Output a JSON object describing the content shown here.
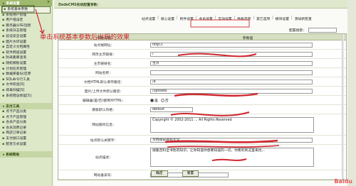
{
  "sidebar": {
    "section1": "系统设置",
    "section1_close": "×",
    "items1": [
      "系统基本参数",
      "系统用户管理",
      "用户组设定",
      "服务器分布/远程",
      "系统日志管理",
      "验证安全设置",
      "图片水印设置",
      "自定义文档属性",
      "软件频道设置",
      "防采集串混淆",
      "随机模板设置",
      "计划任务管理",
      "数据库备份/还原",
      "SQL命令行工具",
      "文件校验[S]",
      "病毒扫描[S]",
      "系统错误修复[S]"
    ],
    "section2": "支付工具",
    "items2": [
      "点卡产品分类",
      "点卡产品管理",
      "会员产品分类",
      "会员消费记录",
      "商店订单记录",
      "支付接口设置",
      "配货方式设置"
    ],
    "section3": "系统帮助"
  },
  "main": {
    "title": "DedeCMS系统配置参数：",
    "tabs": [
      "站点设置",
      "核心设置",
      "附件设置",
      "会员设置",
      "互动设置",
      "性能选项",
      "其它选项",
      "模块设置",
      "添加新变量"
    ],
    "group_label": "配置搜索：",
    "header": {
      "col1": "参数说明",
      "col2": "参数值"
    },
    "rows": [
      {
        "label": "站点根网址：",
        "value": "http://"
      },
      {
        "label": "网页主页链接：",
        "value": "/"
      },
      {
        "label": "主页链接名：",
        "value": "主页"
      },
      {
        "label": "网站名称：",
        "value": ""
      },
      {
        "label": "文档HTML默认保存路径：",
        "value": "/a"
      },
      {
        "label": "图片/上传文件默认路径：",
        "value": "/uploads"
      },
      {
        "label": "编辑器(是/否)使用XHTML：",
        "value": ""
      },
      {
        "label": "模板默认风格：",
        "value": "default"
      },
      {
        "label": "网站版权信息：",
        "value": "Copyright © 2002-2011 ... All Rights Reserved"
      },
      {
        "label": "站点默认关键字：",
        "value": "文档搜索教程大全"
      },
      {
        "label": "站点描述：",
        "value": "搜集百科全书性的知识，让你知道你想要知道的一切，你要的到这里来找..."
      },
      {
        "label": "网站备案号：",
        "value": "粤ICP备"
      }
    ],
    "radio": {
      "yes": "是",
      "no": "否"
    },
    "buttons": {
      "ok": "确定",
      "reset": "重置"
    }
  },
  "annotation": "单击系统基本参数后出现的效果",
  "watermark": "Baidu"
}
